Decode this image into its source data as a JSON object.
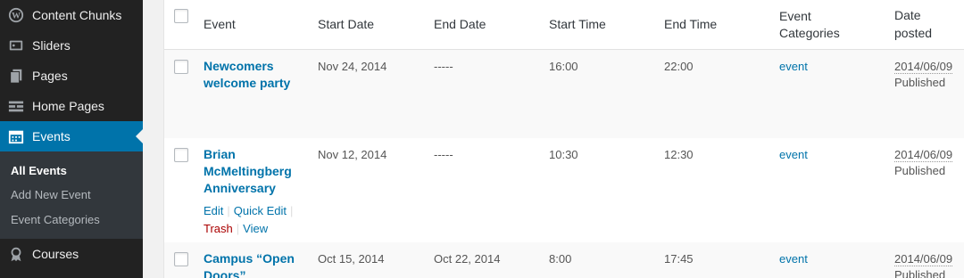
{
  "sidebar": {
    "items": [
      {
        "label": "Content Chunks",
        "icon": "content-chunks-icon"
      },
      {
        "label": "Sliders",
        "icon": "sliders-icon"
      },
      {
        "label": "Pages",
        "icon": "pages-icon"
      },
      {
        "label": "Home Pages",
        "icon": "home-pages-icon"
      },
      {
        "label": "Events",
        "icon": "calendar-icon",
        "active": true
      },
      {
        "label": "Courses",
        "icon": "courses-icon"
      }
    ],
    "submenu": [
      "All Events",
      "Add New Event",
      "Event Categories"
    ]
  },
  "table": {
    "headers": {
      "event": "Event",
      "start_date": "Start Date",
      "end_date": "End Date",
      "start_time": "Start Time",
      "end_time": "End Time",
      "categories_1": "Event",
      "categories_2": "Categories",
      "date_posted_1": "Date",
      "date_posted_2": "posted"
    },
    "rows": [
      {
        "title_lines": [
          "Newcomers",
          "welcome party"
        ],
        "start_date": "Nov 24, 2014",
        "end_date": "-----",
        "start_time": "16:00",
        "end_time": "22:00",
        "category": "event",
        "date": "2014/06/09",
        "status": "Published"
      },
      {
        "title_lines": [
          "Brian",
          "McMeltingberg",
          "Anniversary"
        ],
        "start_date": "Nov 12, 2014",
        "end_date": "-----",
        "start_time": "10:30",
        "end_time": "12:30",
        "category": "event",
        "date": "2014/06/09",
        "status": "Published",
        "actions": {
          "edit": "Edit",
          "quick_edit": "Quick Edit",
          "trash": "Trash",
          "view": "View",
          "sep": "|"
        }
      },
      {
        "title_lines": [
          "Campus “Open",
          "Doors”"
        ],
        "start_date": "Oct 15, 2014",
        "end_date": "Oct 22, 2014",
        "start_time": "8:00",
        "end_time": "17:45",
        "category": "event",
        "date": "2014/06/09",
        "status": "Published"
      }
    ]
  },
  "colors": {
    "sidebar_bg": "#222222",
    "active_bg": "#0073aa",
    "link": "#0073aa",
    "trash": "#aa0000"
  }
}
